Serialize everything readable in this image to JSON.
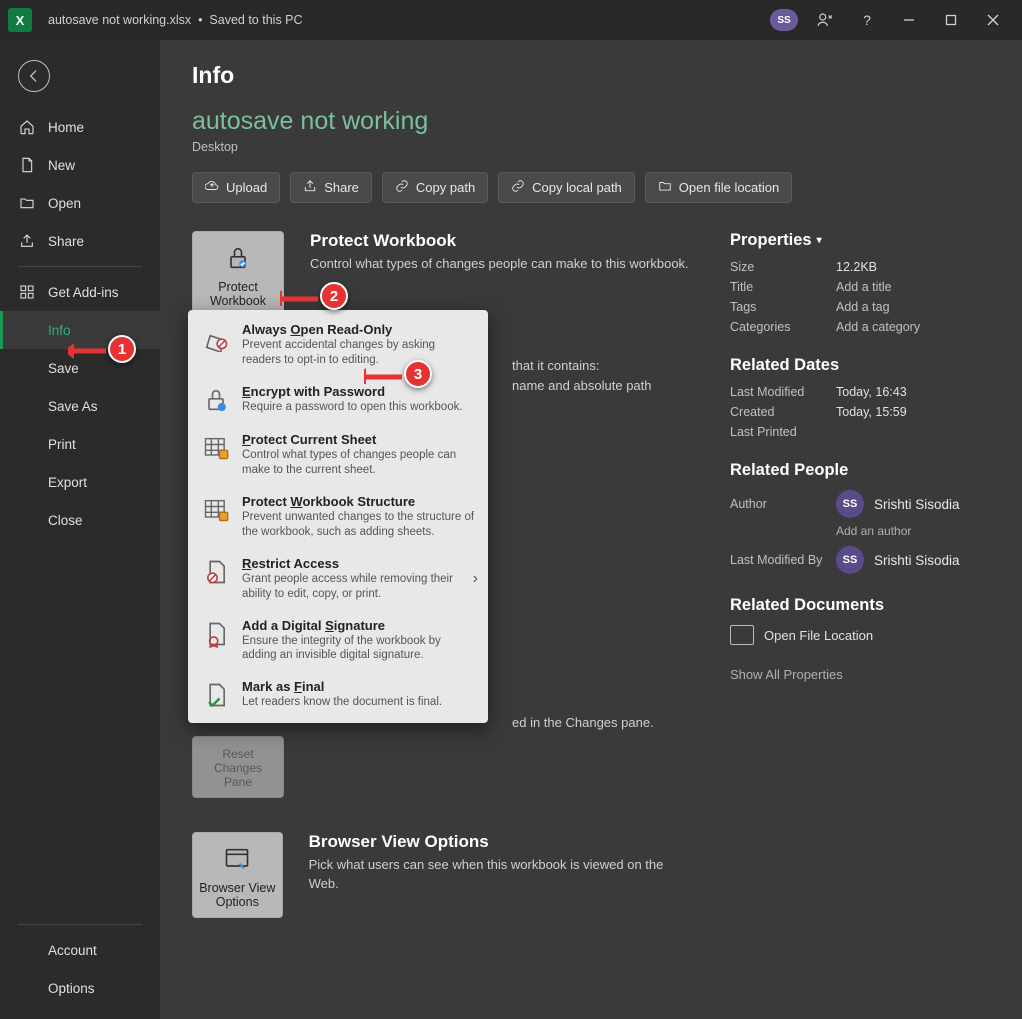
{
  "titlebar": {
    "filename": "autosave not working.xlsx",
    "save_status": "Saved to this PC",
    "user_initials": "SS"
  },
  "sidebar": {
    "items": [
      {
        "label": "Home"
      },
      {
        "label": "New"
      },
      {
        "label": "Open"
      },
      {
        "label": "Share"
      },
      {
        "label": "Get Add-ins"
      },
      {
        "label": "Info"
      },
      {
        "label": "Save"
      },
      {
        "label": "Save As"
      },
      {
        "label": "Print"
      },
      {
        "label": "Export"
      },
      {
        "label": "Close"
      }
    ],
    "bottom": [
      {
        "label": "Account"
      },
      {
        "label": "Options"
      }
    ]
  },
  "page": {
    "title": "Info",
    "doc_title": "autosave not working",
    "doc_location": "Desktop"
  },
  "actions": {
    "upload": "Upload",
    "share": "Share",
    "copy_path": "Copy path",
    "copy_local_path": "Copy local path",
    "open_file_location": "Open file location"
  },
  "sections": {
    "protect": {
      "button": "Protect\nWorkbook",
      "heading": "Protect Workbook",
      "desc": "Control what types of changes people can make to this workbook."
    },
    "inspect_hidden": {
      "tail1": "that it contains:",
      "tail2": "name and absolute path"
    },
    "changes_tail": "ed in the Changes pane.",
    "reset_changes_btn": "Reset Changes\nPane",
    "browser": {
      "button": "Browser View\nOptions",
      "heading": "Browser View Options",
      "desc": "Pick what users can see when this workbook is viewed on the Web."
    }
  },
  "dropdown": [
    {
      "title": "Always Open Read-Only",
      "key": "O",
      "desc": "Prevent accidental changes by asking readers to opt-in to editing."
    },
    {
      "title": "Encrypt with Password",
      "key": "E",
      "desc": "Require a password to open this workbook."
    },
    {
      "title": "Protect Current Sheet",
      "key": "P",
      "desc": "Control what types of changes people can make to the current sheet."
    },
    {
      "title": "Protect Workbook Structure",
      "key": "W",
      "desc": "Prevent unwanted changes to the structure of the workbook, such as adding sheets."
    },
    {
      "title": "Restrict Access",
      "key": "R",
      "desc": "Grant people access while removing their ability to edit, copy, or print.",
      "submenu": true
    },
    {
      "title": "Add a Digital Signature",
      "key": "S",
      "desc": "Ensure the integrity of the workbook by adding an invisible digital signature."
    },
    {
      "title": "Mark as Final",
      "key": "F",
      "desc": "Let readers know the document is final."
    }
  ],
  "properties": {
    "header": "Properties",
    "rows": [
      {
        "label": "Size",
        "value": "12.2KB"
      },
      {
        "label": "Title",
        "value": "Add a title"
      },
      {
        "label": "Tags",
        "value": "Add a tag"
      },
      {
        "label": "Categories",
        "value": "Add a category"
      }
    ],
    "dates_header": "Related Dates",
    "dates": [
      {
        "label": "Last Modified",
        "value": "Today, 16:43"
      },
      {
        "label": "Created",
        "value": "Today, 15:59"
      },
      {
        "label": "Last Printed",
        "value": ""
      }
    ],
    "people_header": "Related People",
    "author_label": "Author",
    "author_name": "Srishti Sisodia",
    "author_initials": "SS",
    "add_author": "Add an author",
    "modified_by_label": "Last Modified By",
    "modified_by_name": "Srishti Sisodia",
    "modified_by_initials": "SS",
    "docs_header": "Related Documents",
    "open_file_location": "Open File Location",
    "show_all": "Show All Properties"
  },
  "callouts": {
    "1": "1",
    "2": "2",
    "3": "3"
  }
}
